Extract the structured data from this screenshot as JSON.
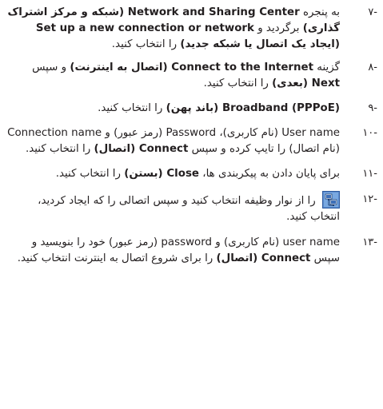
{
  "steps": [
    {
      "number": "-۷",
      "p1": "به پنجره ",
      "b1": "Network and Sharing Center (شبکه و مرکز اشتراک گذاری)",
      "p2": " برگردید و ",
      "b2": "Set up a new connection or network (ایجاد یک اتصال یا شبکه جدید)",
      "p3": " را انتخاب کنید."
    },
    {
      "number": "-۸",
      "p1": "گزینه ",
      "b1": "Connect to the Internet (اتصال به اینترنت)",
      "p2": " و سپس ",
      "b2": "Next (بعدی)",
      "p3": " را انتخاب کنید."
    },
    {
      "number": "-۹",
      "b1": "Broadband (PPPoE) (باند پهن)",
      "p1": " را انتخاب کنید."
    },
    {
      "number": "-۱۰",
      "p1": "User name (نام کاربری)، Password (رمز عبور) و Connection name (نام اتصال) را تایپ کرده و سپس ",
      "b1": "Connect (اتصال)",
      "p2": " را انتخاب کنید."
    },
    {
      "number": "-۱۱",
      "p1": "برای پایان دادن به پیکربندی ها، ",
      "b1": "Close (بستن)",
      "p2": " را انتخاب کنید."
    },
    {
      "number": "-۱۲",
      "icon": "network-taskbar-icon",
      "p1": " را از نوار وظیفه انتخاب کنید و سپس اتصالی را که ایجاد کردید، انتخاب کنید."
    },
    {
      "number": "-۱۳",
      "p1": "user name (نام کاربری) و password (رمز عبور) خود را بنویسید و سپس ",
      "b1": "Connect (اتصال)",
      "p2": " را برای شروع اتصال به اینترنت انتخاب کنید."
    }
  ]
}
